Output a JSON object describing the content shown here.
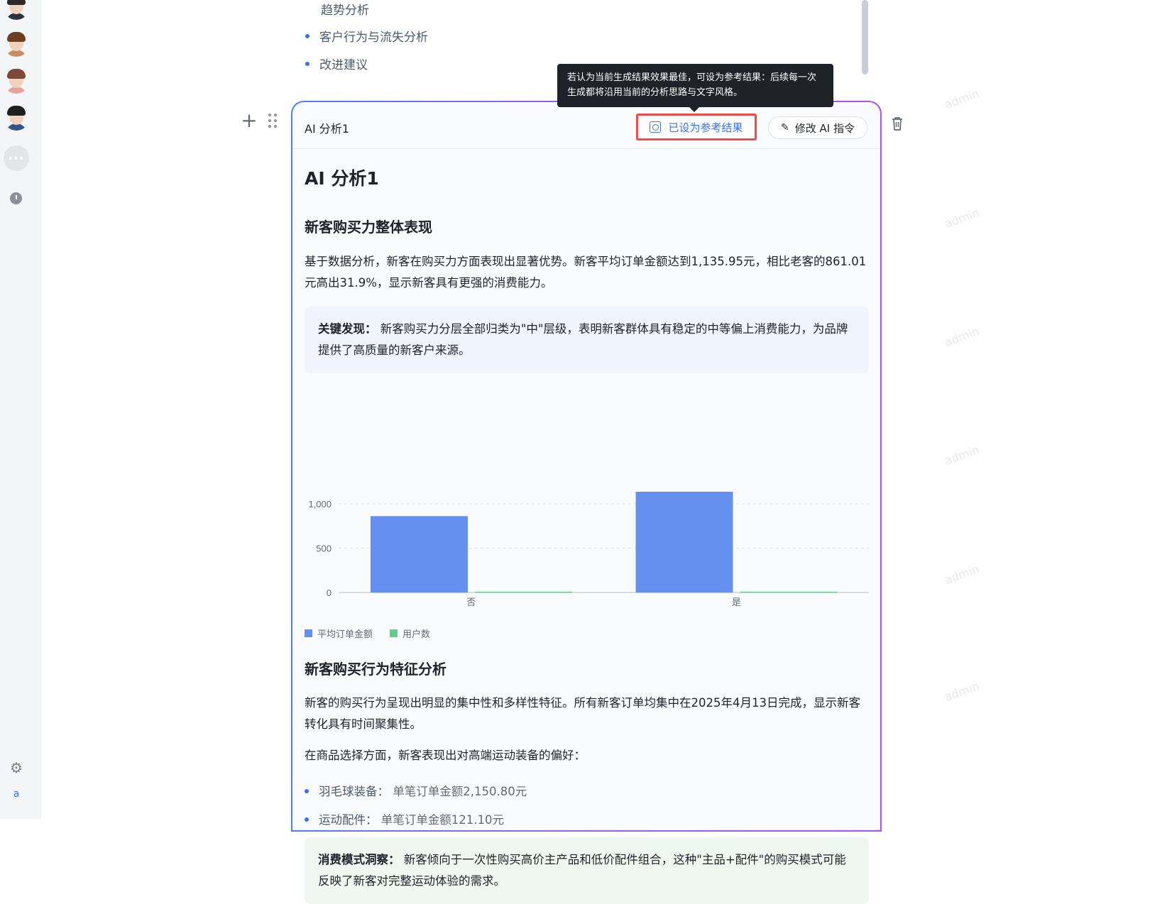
{
  "top_list": {
    "sub_item": "趋势分析",
    "items": [
      "客户行为与流失分析",
      "改进建议"
    ]
  },
  "tooltip": {
    "text": "若认为当前生成结果效果最佳，可设为参考结果：后续每一次生成都将沿用当前的分析思路与文字风格。"
  },
  "block": {
    "label": "AI 分析1",
    "ref_button": "已设为参考结果",
    "edit_button": "修改 AI 指令"
  },
  "content": {
    "title": "AI 分析1",
    "section1": {
      "heading": "新客购买力整体表现",
      "paragraph": "基于数据分析，新客在购买力方面表现出显著优势。新客平均订单金额达到1,135.95元，相比老客的861.01元高出31.9%，显示新客具有更强的消费能力。",
      "callout_label": "关键发现：",
      "callout_text": "新客购买力分层全部归类为\"中\"层级，表明新客群体具有稳定的中等偏上消费能力，为品牌提供了高质量的新客户来源。"
    },
    "section2": {
      "heading": "新客购买行为特征分析",
      "paragraph1": "新客的购买行为呈现出明显的集中性和多样性特征。所有新客订单均集中在2025年4月13日完成，显示新客转化具有时间聚集性。",
      "paragraph2": "在商品选择方面，新客表现出对高端运动装备的偏好：",
      "items": [
        {
          "key": "羽毛球装备：",
          "value": "单笔订单金额2,150.80元"
        },
        {
          "key": "运动配件：",
          "value": "单笔订单金额121.10元"
        }
      ],
      "callout_label": "消费模式洞察：",
      "callout_text": "新客倾向于一次性购买高价主产品和低价配件组合，这种\"主品+配件\"的购买模式可能反映了新客对完整运动体验的需求。"
    }
  },
  "chart_data": {
    "type": "bar",
    "categories": [
      "否",
      "是"
    ],
    "series": [
      {
        "name": "平均订单金额",
        "values": [
          861.01,
          1135.95
        ],
        "color": "#6690f0"
      },
      {
        "name": "用户数",
        "values": [
          1,
          1
        ],
        "color": "#5ed08a"
      }
    ],
    "ylim": [
      0,
      1200
    ],
    "yticks": [
      0,
      500,
      1000
    ],
    "ytick_labels": [
      "0",
      "500",
      "1,000"
    ],
    "grid": true,
    "legend": "bottom-left"
  },
  "colors": {
    "accent": "#3370ff",
    "highlight_border": "#f04a48"
  }
}
